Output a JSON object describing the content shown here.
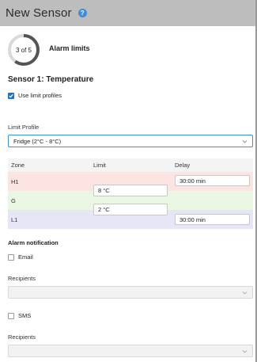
{
  "window": {
    "title": "New Sensor",
    "help_icon": "question-icon"
  },
  "wizard": {
    "step_text": "3 of 5",
    "step_current": 3,
    "step_total": 5,
    "step_title": "Alarm limits"
  },
  "sensor": {
    "title": "Sensor 1: Temperature"
  },
  "use_limit_profiles": {
    "label": "Use limit profiles",
    "checked": true
  },
  "limit_profile": {
    "label": "Limit Profile",
    "value": "Fridge (2°C - 8°C)"
  },
  "zones": {
    "headers": {
      "zone": "Zone",
      "limit": "Limit",
      "delay": "Delay"
    },
    "rows": [
      {
        "zone": "H1",
        "delay": "30:00 min",
        "color": "#fbe4e2"
      },
      {
        "zone": "G",
        "color": "#e9f7e3"
      },
      {
        "zone": "L1",
        "delay": "30:00 min",
        "color": "#e6e6f6"
      }
    ],
    "limits": {
      "upper": "8 °C",
      "lower": "2 °C"
    }
  },
  "alarm_notification": {
    "title": "Alarm notification",
    "email": {
      "label": "Email",
      "checked": false
    },
    "email_recipients": {
      "label": "Recipients",
      "value": ""
    },
    "sms": {
      "label": "SMS",
      "checked": false
    },
    "sms_recipients": {
      "label": "Recipients",
      "value": ""
    }
  },
  "colors": {
    "accent": "#3b8fe0",
    "titlebar": "#bdbdbd"
  }
}
